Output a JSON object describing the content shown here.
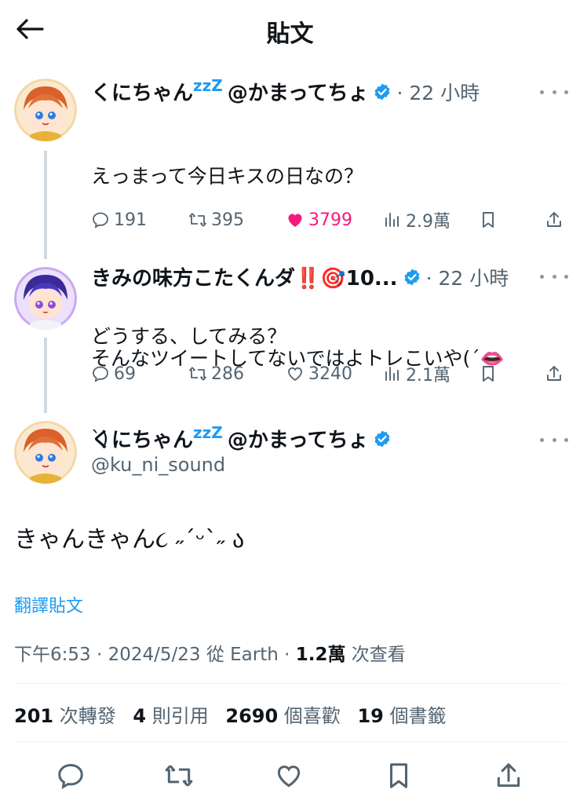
{
  "header": {
    "title": "貼文"
  },
  "thread": [
    {
      "name": "くにちゃん",
      "zz": "zzZ",
      "handle_suffix": "@かまってちょ",
      "time": "· 22 小時",
      "lines": [
        "えっまって今日キスの日なの？",
        "",
        "どうする、してみる？"
      ],
      "stats": {
        "replies": "191",
        "retweets": "395",
        "likes": "3799",
        "views": "2.9萬"
      },
      "liked": true
    },
    {
      "name": "きみの味方こたくんダ‼️🎯10...",
      "time": "· 22 小時",
      "lines": [
        "そんなツイートしてないではよトレこいや(ˊ👄",
        "ˋ)"
      ],
      "stats": {
        "replies": "69",
        "retweets": "286",
        "likes": "3240",
        "views": "2.1萬"
      },
      "liked": false
    }
  ],
  "main_tweet": {
    "name": "くにちゃん",
    "zz": "zzZ",
    "handle_suffix": "@かまってちょ",
    "handle": "@ku_ni_sound",
    "text": "きゃんきゃん૮ ˶ˊᵕˋ˶ ა",
    "translate": "翻譯貼文",
    "time": "下午6:53 · 2024/5/23 從 Earth · ",
    "views_count": "1.2萬",
    "views_label": " 次查看"
  },
  "engagement": {
    "retweets_count": "201",
    "retweets_label": " 次轉發",
    "quotes_count": "4",
    "quotes_label": " 則引用",
    "likes_count": "2690",
    "likes_label": " 個喜歡",
    "bookmarks_count": "19",
    "bookmarks_label": " 個書籤"
  },
  "colors": {
    "accent": "#1d9bf0",
    "like": "#f91880",
    "muted": "#536471",
    "text": "#0f1419"
  }
}
